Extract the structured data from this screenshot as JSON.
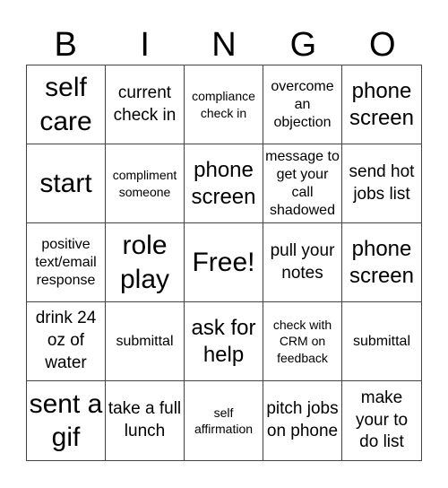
{
  "header": {
    "letters": [
      "B",
      "I",
      "N",
      "G",
      "O"
    ]
  },
  "cells": [
    {
      "text": "self care",
      "size": "s-xl"
    },
    {
      "text": "current check in",
      "size": "s-md"
    },
    {
      "text": "compliance check in",
      "size": "s-xs"
    },
    {
      "text": "overcome an objection",
      "size": "s-sm"
    },
    {
      "text": "phone screen",
      "size": "s-lg"
    },
    {
      "text": "start",
      "size": "s-xl"
    },
    {
      "text": "compliment someone",
      "size": "s-xs"
    },
    {
      "text": "phone screen",
      "size": "s-lg"
    },
    {
      "text": "message to get your call shadowed",
      "size": "s-sm"
    },
    {
      "text": "send hot jobs list",
      "size": "s-md"
    },
    {
      "text": "positive text/email response",
      "size": "s-sm"
    },
    {
      "text": "role play",
      "size": "s-xl"
    },
    {
      "text": "Free!",
      "size": "s-xl"
    },
    {
      "text": "pull your notes",
      "size": "s-md"
    },
    {
      "text": "phone screen",
      "size": "s-lg"
    },
    {
      "text": "drink 24 oz of water",
      "size": "s-md"
    },
    {
      "text": "submittal",
      "size": "s-sm"
    },
    {
      "text": "ask for help",
      "size": "s-lg"
    },
    {
      "text": "check with CRM on feedback",
      "size": "s-xs"
    },
    {
      "text": "submittal",
      "size": "s-sm"
    },
    {
      "text": "sent a gif",
      "size": "s-xl"
    },
    {
      "text": "take a full lunch",
      "size": "s-md"
    },
    {
      "text": "self affirmation",
      "size": "s-xs"
    },
    {
      "text": "pitch jobs on phone",
      "size": "s-md"
    },
    {
      "text": "make your to do list",
      "size": "s-md"
    }
  ]
}
